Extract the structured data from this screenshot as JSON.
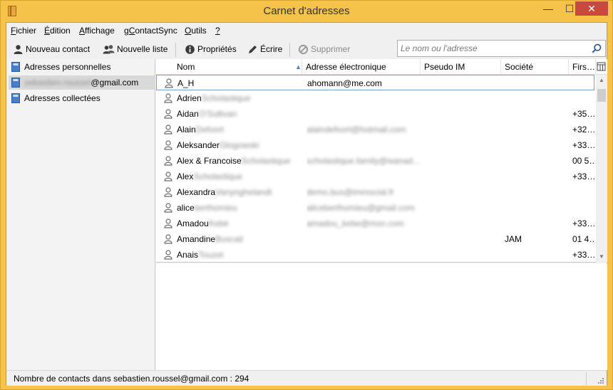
{
  "window": {
    "title": "Carnet d'adresses",
    "minimize": "—",
    "maximize": "☐",
    "close": "✕"
  },
  "menu": {
    "fichier": {
      "u": "F",
      "rest": "ichier"
    },
    "edition": {
      "u": "É",
      "rest": "dition"
    },
    "affichage": {
      "u": "A",
      "rest": "ffichage"
    },
    "gcontactsync": {
      "pre": "g",
      "u": "C",
      "rest": "ontactSync"
    },
    "outils": {
      "u": "O",
      "rest": "utils"
    },
    "aide": {
      "u": "?",
      "rest": ""
    }
  },
  "toolbar": {
    "new_contact": "Nouveau contact",
    "new_list": "Nouvelle liste",
    "properties": "Propriétés",
    "write": "Écrire",
    "delete": "Supprimer"
  },
  "search": {
    "placeholder": "Le nom ou l'adresse",
    "value": ""
  },
  "sidebar": {
    "books": [
      {
        "label": "Adresses personnelles"
      },
      {
        "label_blur": "sebastien.roussel",
        "label": "@gmail.com"
      },
      {
        "label": "Adresses collectées"
      }
    ]
  },
  "columns": {
    "nom": "Nom",
    "email": "Adresse électronique",
    "im": "Pseudo IM",
    "company": "Société",
    "first": "Firs…"
  },
  "contacts": [
    {
      "name": "A_H",
      "name_blur": "",
      "email": "ahomann@me.com",
      "email_blur": "",
      "company": "",
      "first": ""
    },
    {
      "name": "Adrien",
      "name_blur": "Scholastique",
      "email": "",
      "email_blur": "",
      "company": "",
      "first": ""
    },
    {
      "name": "Aidan",
      "name_blur": "O'Sullivan",
      "email": "",
      "email_blur": "",
      "company": "",
      "first": "+35…"
    },
    {
      "name": "Alain",
      "name_blur": "Defoort",
      "email": "",
      "email_blur": "alaindefoort@hotmail.com",
      "company": "",
      "first": "+32…"
    },
    {
      "name": "Aleksander",
      "name_blur": "Glogowski",
      "email": "",
      "email_blur": "",
      "company": "",
      "first": "+33…"
    },
    {
      "name": "Alex & Francoise",
      "name_blur": "Scholastique",
      "email": "",
      "email_blur": "scholastique.family@wanad…",
      "company": "",
      "first": "00 5…"
    },
    {
      "name": "Alex",
      "name_blur": "Scholastique",
      "email": "",
      "email_blur": "",
      "company": "",
      "first": "+33…"
    },
    {
      "name": "Alexandra",
      "name_blur": "Vanynghelandt",
      "email": "",
      "email_blur": "demo.bus@immocial.fr",
      "company": "",
      "first": ""
    },
    {
      "name": "alice",
      "name_blur": "berthomieu",
      "email": "",
      "email_blur": "aliceberthomieu@gmail.com",
      "company": "",
      "first": ""
    },
    {
      "name": "Amadou",
      "name_blur": "Kebé",
      "email": "",
      "email_blur": "amadou_kebe@msn.com",
      "company": "",
      "first": "+33…"
    },
    {
      "name": "Amandine",
      "name_blur": "Buscail",
      "email": "",
      "email_blur": "",
      "company": "JAM",
      "first": "01 4…"
    },
    {
      "name": "Anais",
      "name_blur": "Touzet",
      "email": "",
      "email_blur": "",
      "company": "",
      "first": "+33…"
    }
  ],
  "status": {
    "text": "Nombre de contacts dans sebastien.roussel@gmail.com : 294"
  },
  "colors": {
    "title_bar": "#f5c34a",
    "close_button": "#c74a3f",
    "focus_border": "#7da2ce"
  }
}
